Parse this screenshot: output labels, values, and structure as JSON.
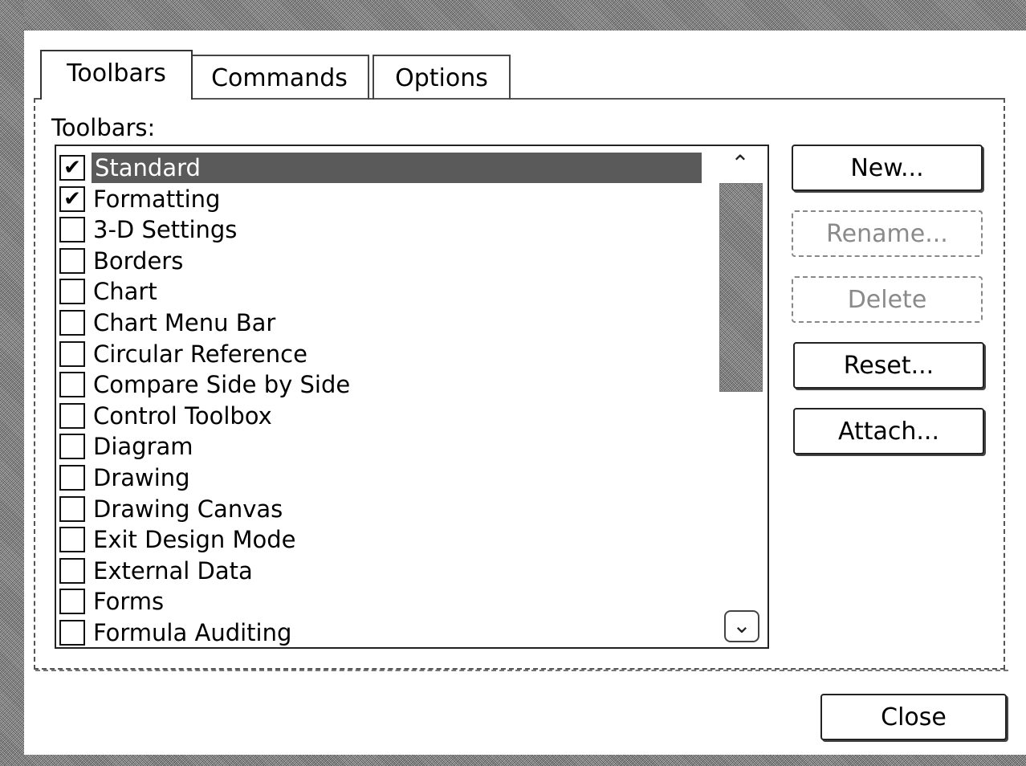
{
  "tabs": [
    {
      "label": "Toolbars",
      "active": true
    },
    {
      "label": "Commands",
      "active": false
    },
    {
      "label": "Options",
      "active": false
    }
  ],
  "list": {
    "caption": "Toolbars:",
    "items": [
      {
        "label": "Standard",
        "checked": true,
        "selected": true
      },
      {
        "label": "Formatting",
        "checked": true,
        "selected": false
      },
      {
        "label": "3-D Settings",
        "checked": false,
        "selected": false
      },
      {
        "label": "Borders",
        "checked": false,
        "selected": false
      },
      {
        "label": "Chart",
        "checked": false,
        "selected": false
      },
      {
        "label": "Chart Menu Bar",
        "checked": false,
        "selected": false
      },
      {
        "label": "Circular Reference",
        "checked": false,
        "selected": false
      },
      {
        "label": "Compare Side by Side",
        "checked": false,
        "selected": false
      },
      {
        "label": "Control Toolbox",
        "checked": false,
        "selected": false
      },
      {
        "label": "Diagram",
        "checked": false,
        "selected": false
      },
      {
        "label": "Drawing",
        "checked": false,
        "selected": false
      },
      {
        "label": "Drawing Canvas",
        "checked": false,
        "selected": false
      },
      {
        "label": "Exit Design Mode",
        "checked": false,
        "selected": false
      },
      {
        "label": "External Data",
        "checked": false,
        "selected": false
      },
      {
        "label": "Forms",
        "checked": false,
        "selected": false
      },
      {
        "label": "Formula Auditing",
        "checked": false,
        "selected": false
      }
    ],
    "scroll_up_icon": "chevron-up-icon",
    "scroll_down_icon": "chevron-down-icon"
  },
  "buttons": {
    "new": {
      "label": "New...",
      "enabled": true
    },
    "rename": {
      "label": "Rename...",
      "enabled": false
    },
    "delete": {
      "label": "Delete",
      "enabled": false
    },
    "reset": {
      "label": "Reset...",
      "enabled": true
    },
    "attach": {
      "label": "Attach...",
      "enabled": true
    },
    "close": {
      "label": "Close",
      "enabled": true
    }
  }
}
